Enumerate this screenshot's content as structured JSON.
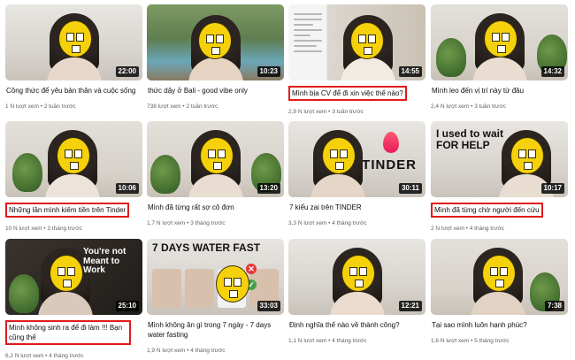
{
  "videos": [
    {
      "title": "Công thức để yêu bản thân và cuộc sống",
      "views": "1 N lượt xem",
      "age": "2 tuần trước",
      "duration": "22:00",
      "boxed": false
    },
    {
      "title": "thức dậy ở Bali - good vibe only",
      "views": "738 lượt xem",
      "age": "2 tuần trước",
      "duration": "10:23",
      "boxed": false
    },
    {
      "title": "Mình bịa CV để đi xin việc thế nào?",
      "views": "2,9 N lượt xem",
      "age": "3 tuần trước",
      "duration": "14:55",
      "boxed": true
    },
    {
      "title": "Mình leo đến vị trí này từ đâu",
      "views": "2,4 N lượt xem",
      "age": "3 tuần trước",
      "duration": "14:32",
      "boxed": false
    },
    {
      "title": "Những lần mình kiếm tiền trên Tinder",
      "views": "10 N lượt xem",
      "age": "3 tháng trước",
      "duration": "10:06",
      "boxed": true
    },
    {
      "title": "Mình đã từng rất sợ cô đơn",
      "views": "1,7 N lượt xem",
      "age": "3 tháng trước",
      "duration": "13:20",
      "boxed": false
    },
    {
      "title": "7 kiểu zai trên TINDER",
      "views": "3,3 N lượt xem",
      "age": "4 tháng trước",
      "duration": "30:11",
      "boxed": false,
      "overlay": "TINDER"
    },
    {
      "title": "Mình đã từng chờ người đến cứu",
      "views": "2 N lượt xem",
      "age": "4 tháng trước",
      "duration": "10:17",
      "boxed": true,
      "overlay": "I used to wait\nFOR HELP"
    },
    {
      "title": "Mình không sinh ra để đi làm !!! Bạn cũng thế",
      "views": "6,2 N lượt xem",
      "age": "4 tháng trước",
      "duration": "25:10",
      "boxed": true,
      "overlay": "You're not\nMeant to Work"
    },
    {
      "title": "Mình không ăn gì trong 7 ngày - 7 days water fasting",
      "views": "1,9 N lượt xem",
      "age": "4 tháng trước",
      "duration": "33:03",
      "boxed": false,
      "overlay": "7 DAYS WATER FAST"
    },
    {
      "title": "Định nghĩa thế nào về thành công?",
      "views": "1,1 N lượt xem",
      "age": "4 tháng trước",
      "duration": "12:21",
      "boxed": false
    },
    {
      "title": "Tại sao mình luôn hạnh phúc?",
      "views": "1,6 N lượt xem",
      "age": "5 tháng trước",
      "duration": "7:38",
      "boxed": false
    }
  ]
}
